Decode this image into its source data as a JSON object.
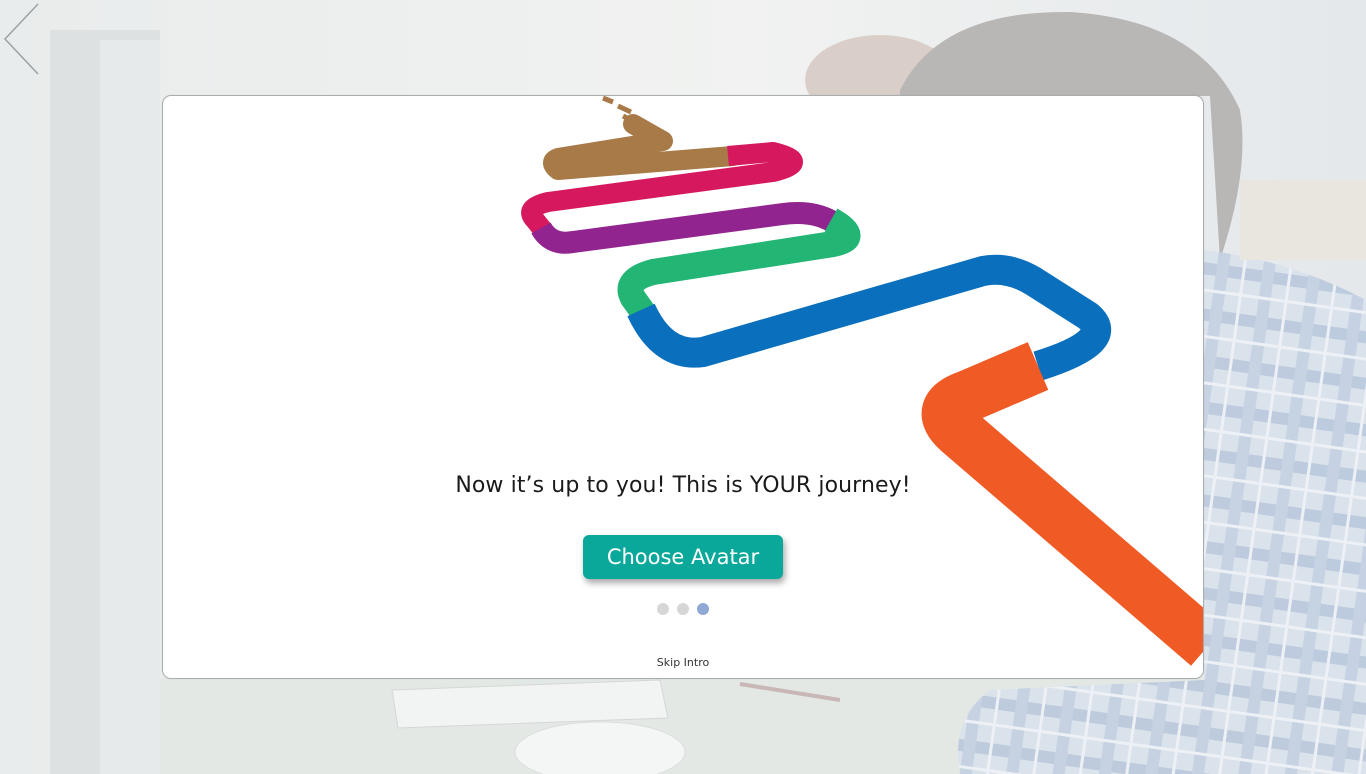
{
  "slide": {
    "headline": "Now it’s up to you! This is YOUR journey!",
    "cta_label": "Choose Avatar",
    "skip_label": "Skip Intro",
    "total_slides": 3,
    "active_slide": 3
  },
  "navigation": {
    "prev_icon": "chevron-left-icon"
  },
  "colors": {
    "cta_background": "#0aa89a",
    "dot_inactive": "#d6d6d6",
    "dot_active": "#8fa8d4",
    "road_brown": "#a87a48",
    "road_pink": "#d6195f",
    "road_purple": "#91248f",
    "road_green": "#22b574",
    "road_blue": "#0a6fbd",
    "road_orange": "#f05a24"
  }
}
